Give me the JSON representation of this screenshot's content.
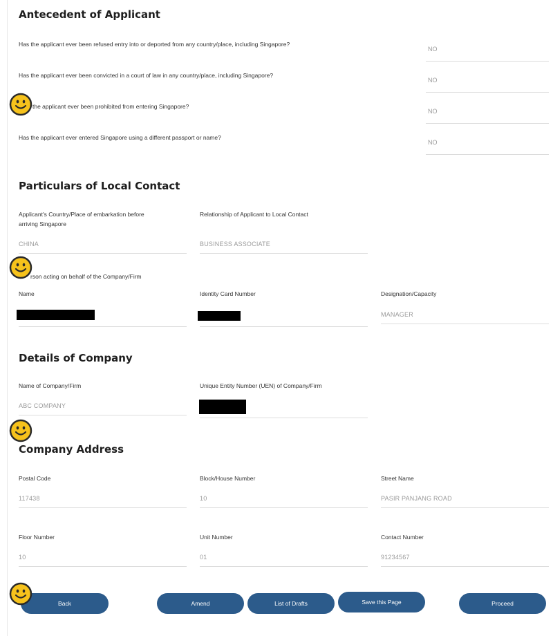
{
  "antecedent": {
    "title": "Antecedent of Applicant",
    "questions": [
      {
        "text": "Has the applicant ever been refused entry into or deported from any country/place, including Singapore?",
        "answer": "NO"
      },
      {
        "text": "Has the applicant ever been convicted in a court of law in any country/place, including Singapore?",
        "answer": "NO"
      },
      {
        "text": "the applicant ever been prohibited from entering Singapore?",
        "answer": "NO"
      },
      {
        "text": "Has the applicant ever entered Singapore using a different passport or name?",
        "answer": "NO"
      }
    ]
  },
  "local_contact": {
    "title": "Particulars of Local Contact",
    "embark_label_line1": "Applicant's Country/Place of embarkation before",
    "embark_label_line2": "arriving Singapore",
    "embark_value": "CHINA",
    "relationship_label": "Relationship of Applicant to Local Contact",
    "relationship_value": "BUSINESS ASSOCIATE",
    "person_acting_label": "rson acting on behalf of the Company/Firm",
    "name_label": "Name",
    "ic_label": "Identity Card Number",
    "designation_label": "Designation/Capacity",
    "designation_value": "MANAGER"
  },
  "company": {
    "title": "Details of Company",
    "name_label": "Name of Company/Firm",
    "name_value": "ABC COMPANY",
    "uen_label": "Unique Entity Number (UEN) of Company/Firm"
  },
  "address": {
    "title": "Company Address",
    "postal_label": "Postal Code",
    "postal_value": "117438",
    "block_label": "Block/House Number",
    "block_value": "10",
    "street_label": "Street Name",
    "street_value": "PASIR PANJANG ROAD",
    "floor_label": "Floor Number",
    "floor_value": "10",
    "unit_label": "Unit Number",
    "unit_value": "01",
    "contact_label": "Contact Number",
    "contact_value": "91234567"
  },
  "buttons": {
    "back": "Back",
    "amend": "Amend",
    "drafts": "List of Drafts",
    "save": "Save this Page",
    "proceed": "Proceed"
  },
  "colors": {
    "button": "#2c5b8b",
    "smiley_fill": "#f6c21c",
    "smiley_outline": "#2a2a2a",
    "redaction": "#000000"
  }
}
